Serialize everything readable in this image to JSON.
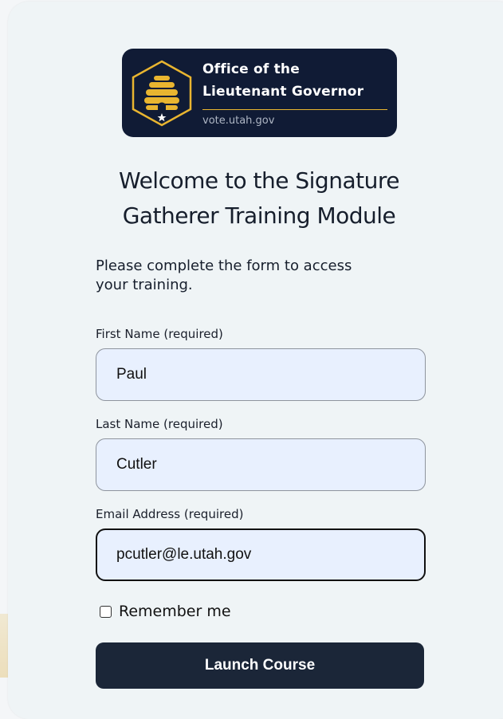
{
  "logo": {
    "line1": "Office of the",
    "line2": "Lieutenant Governor",
    "url": "vote.utah.gov",
    "colors": {
      "background": "#101b35",
      "accent": "#e9b530"
    },
    "icon": "beehive-seal-icon"
  },
  "heading": {
    "line1": "Welcome to the Signature",
    "line2": "Gatherer Training Module"
  },
  "intro": "Please complete the form to access your training.",
  "form": {
    "first_name": {
      "label": "First Name (required)",
      "value": "Paul"
    },
    "last_name": {
      "label": "Last Name (required)",
      "value": "Cutler"
    },
    "email": {
      "label": "Email Address (required)",
      "value": "pcutler@le.utah.gov"
    },
    "remember_label": "Remember me",
    "submit_label": "Launch Course"
  },
  "colors": {
    "card_bg": "#eff4f6",
    "input_bg": "#e8f0fe",
    "button_bg": "#1b2638",
    "text": "#161e2c"
  }
}
